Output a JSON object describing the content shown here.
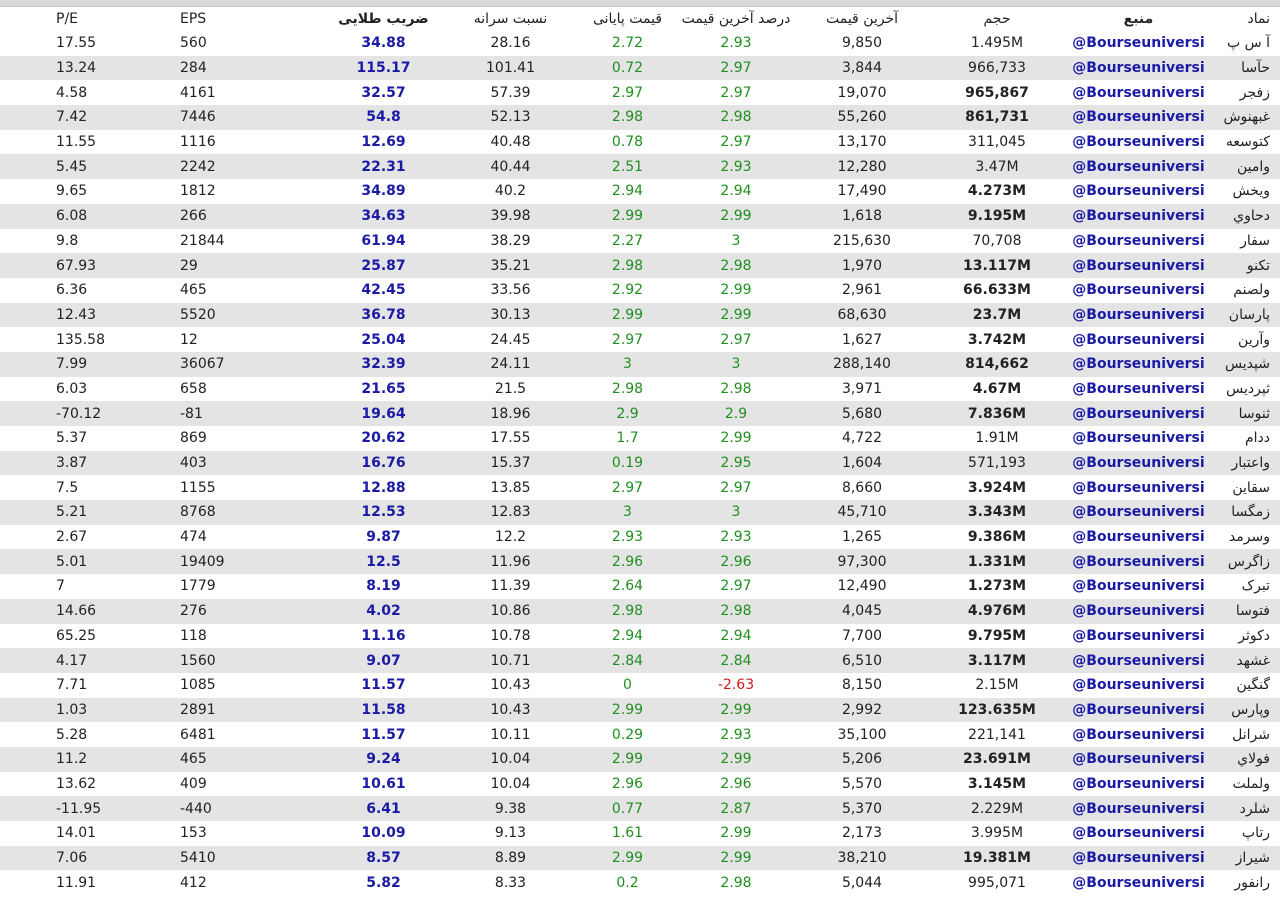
{
  "columns": {
    "pe": "P/E",
    "eps": "EPS",
    "gold": "ضریب طلایی",
    "ratio": "نسبت سرانه",
    "final": "قیمت پایانی",
    "pct_last": "درصد آخرین قیمت",
    "last": "آخرین قیمت",
    "volume": "حجم",
    "source": "منبع",
    "symbol": "نماد"
  },
  "rows": [
    {
      "pe": "17.55",
      "eps": "560",
      "gold": "34.88",
      "ratio": "28.16",
      "final": "2.72",
      "pct": "2.93",
      "last": "9,850",
      "vol": "1.495M",
      "vol_bold": false,
      "src": "@Bourseuniversi",
      "sym": "آ س پ",
      "pct_neg": false
    },
    {
      "pe": "13.24",
      "eps": "284",
      "gold": "115.17",
      "ratio": "101.41",
      "final": "0.72",
      "pct": "2.97",
      "last": "3,844",
      "vol": "966,733",
      "vol_bold": false,
      "src": "@Bourseuniversi",
      "sym": "حآسا",
      "pct_neg": false
    },
    {
      "pe": "4.58",
      "eps": "4161",
      "gold": "32.57",
      "ratio": "57.39",
      "final": "2.97",
      "pct": "2.97",
      "last": "19,070",
      "vol": "965,867",
      "vol_bold": true,
      "src": "@Bourseuniversi",
      "sym": "زفجر",
      "pct_neg": false
    },
    {
      "pe": "7.42",
      "eps": "7446",
      "gold": "54.8",
      "ratio": "52.13",
      "final": "2.98",
      "pct": "2.98",
      "last": "55,260",
      "vol": "861,731",
      "vol_bold": true,
      "src": "@Bourseuniversi",
      "sym": "غبهنوش",
      "pct_neg": false
    },
    {
      "pe": "11.55",
      "eps": "1116",
      "gold": "12.69",
      "ratio": "40.48",
      "final": "0.78",
      "pct": "2.97",
      "last": "13,170",
      "vol": "311,045",
      "vol_bold": false,
      "src": "@Bourseuniversi",
      "sym": "کتوسعه",
      "pct_neg": false
    },
    {
      "pe": "5.45",
      "eps": "2242",
      "gold": "22.31",
      "ratio": "40.44",
      "final": "2.51",
      "pct": "2.93",
      "last": "12,280",
      "vol": "3.47M",
      "vol_bold": false,
      "src": "@Bourseuniversi",
      "sym": "وامین",
      "pct_neg": false
    },
    {
      "pe": "9.65",
      "eps": "1812",
      "gold": "34.89",
      "ratio": "40.2",
      "final": "2.94",
      "pct": "2.94",
      "last": "17,490",
      "vol": "4.273M",
      "vol_bold": true,
      "src": "@Bourseuniversi",
      "sym": "ویخش",
      "pct_neg": false
    },
    {
      "pe": "6.08",
      "eps": "266",
      "gold": "34.63",
      "ratio": "39.98",
      "final": "2.99",
      "pct": "2.99",
      "last": "1,618",
      "vol": "9.195M",
      "vol_bold": true,
      "src": "@Bourseuniversi",
      "sym": "دحاوي",
      "pct_neg": false
    },
    {
      "pe": "9.8",
      "eps": "21844",
      "gold": "61.94",
      "ratio": "38.29",
      "final": "2.27",
      "pct": "3",
      "last": "215,630",
      "vol": "70,708",
      "vol_bold": false,
      "src": "@Bourseuniversi",
      "sym": "سفار",
      "pct_neg": false
    },
    {
      "pe": "67.93",
      "eps": "29",
      "gold": "25.87",
      "ratio": "35.21",
      "final": "2.98",
      "pct": "2.98",
      "last": "1,970",
      "vol": "13.117M",
      "vol_bold": true,
      "src": "@Bourseuniversi",
      "sym": "تکنو",
      "pct_neg": false
    },
    {
      "pe": "6.36",
      "eps": "465",
      "gold": "42.45",
      "ratio": "33.56",
      "final": "2.92",
      "pct": "2.99",
      "last": "2,961",
      "vol": "66.633M",
      "vol_bold": true,
      "src": "@Bourseuniversi",
      "sym": "ولصنم",
      "pct_neg": false
    },
    {
      "pe": "12.43",
      "eps": "5520",
      "gold": "36.78",
      "ratio": "30.13",
      "final": "2.99",
      "pct": "2.99",
      "last": "68,630",
      "vol": "23.7M",
      "vol_bold": true,
      "src": "@Bourseuniversi",
      "sym": "پارسان",
      "pct_neg": false
    },
    {
      "pe": "135.58",
      "eps": "12",
      "gold": "25.04",
      "ratio": "24.45",
      "final": "2.97",
      "pct": "2.97",
      "last": "1,627",
      "vol": "3.742M",
      "vol_bold": true,
      "src": "@Bourseuniversi",
      "sym": "وآرین",
      "pct_neg": false
    },
    {
      "pe": "7.99",
      "eps": "36067",
      "gold": "32.39",
      "ratio": "24.11",
      "final": "3",
      "pct": "3",
      "last": "288,140",
      "vol": "814,662",
      "vol_bold": true,
      "src": "@Bourseuniversi",
      "sym": "شپدیس",
      "pct_neg": false
    },
    {
      "pe": "6.03",
      "eps": "658",
      "gold": "21.65",
      "ratio": "21.5",
      "final": "2.98",
      "pct": "2.98",
      "last": "3,971",
      "vol": "4.67M",
      "vol_bold": true,
      "src": "@Bourseuniversi",
      "sym": "ثپردیس",
      "pct_neg": false
    },
    {
      "pe": "-70.12",
      "eps": "-81",
      "gold": "19.64",
      "ratio": "18.96",
      "final": "2.9",
      "pct": "2.9",
      "last": "5,680",
      "vol": "7.836M",
      "vol_bold": true,
      "src": "@Bourseuniversi",
      "sym": "ثنوسا",
      "pct_neg": false
    },
    {
      "pe": "5.37",
      "eps": "869",
      "gold": "20.62",
      "ratio": "17.55",
      "final": "1.7",
      "pct": "2.99",
      "last": "4,722",
      "vol": "1.91M",
      "vol_bold": false,
      "src": "@Bourseuniversi",
      "sym": "ددام",
      "pct_neg": false
    },
    {
      "pe": "3.87",
      "eps": "403",
      "gold": "16.76",
      "ratio": "15.37",
      "final": "0.19",
      "pct": "2.95",
      "last": "1,604",
      "vol": "571,193",
      "vol_bold": false,
      "src": "@Bourseuniversi",
      "sym": "واعتبار",
      "pct_neg": false
    },
    {
      "pe": "7.5",
      "eps": "1155",
      "gold": "12.88",
      "ratio": "13.85",
      "final": "2.97",
      "pct": "2.97",
      "last": "8,660",
      "vol": "3.924M",
      "vol_bold": true,
      "src": "@Bourseuniversi",
      "sym": "سقاین",
      "pct_neg": false
    },
    {
      "pe": "5.21",
      "eps": "8768",
      "gold": "12.53",
      "ratio": "12.83",
      "final": "3",
      "pct": "3",
      "last": "45,710",
      "vol": "3.343M",
      "vol_bold": true,
      "src": "@Bourseuniversi",
      "sym": "زمگسا",
      "pct_neg": false
    },
    {
      "pe": "2.67",
      "eps": "474",
      "gold": "9.87",
      "ratio": "12.2",
      "final": "2.93",
      "pct": "2.93",
      "last": "1,265",
      "vol": "9.386M",
      "vol_bold": true,
      "src": "@Bourseuniversi",
      "sym": "وسرمد",
      "pct_neg": false
    },
    {
      "pe": "5.01",
      "eps": "19409",
      "gold": "12.5",
      "ratio": "11.96",
      "final": "2.96",
      "pct": "2.96",
      "last": "97,300",
      "vol": "1.331M",
      "vol_bold": true,
      "src": "@Bourseuniversi",
      "sym": "زاگرس",
      "pct_neg": false
    },
    {
      "pe": "7",
      "eps": "1779",
      "gold": "8.19",
      "ratio": "11.39",
      "final": "2.64",
      "pct": "2.97",
      "last": "12,490",
      "vol": "1.273M",
      "vol_bold": true,
      "src": "@Bourseuniversi",
      "sym": "تبرک",
      "pct_neg": false
    },
    {
      "pe": "14.66",
      "eps": "276",
      "gold": "4.02",
      "ratio": "10.86",
      "final": "2.98",
      "pct": "2.98",
      "last": "4,045",
      "vol": "4.976M",
      "vol_bold": true,
      "src": "@Bourseuniversi",
      "sym": "فتوسا",
      "pct_neg": false
    },
    {
      "pe": "65.25",
      "eps": "118",
      "gold": "11.16",
      "ratio": "10.78",
      "final": "2.94",
      "pct": "2.94",
      "last": "7,700",
      "vol": "9.795M",
      "vol_bold": true,
      "src": "@Bourseuniversi",
      "sym": "دکوثر",
      "pct_neg": false
    },
    {
      "pe": "4.17",
      "eps": "1560",
      "gold": "9.07",
      "ratio": "10.71",
      "final": "2.84",
      "pct": "2.84",
      "last": "6,510",
      "vol": "3.117M",
      "vol_bold": true,
      "src": "@Bourseuniversi",
      "sym": "غشهد",
      "pct_neg": false
    },
    {
      "pe": "7.71",
      "eps": "1085",
      "gold": "11.57",
      "ratio": "10.43",
      "final": "0",
      "pct": "-2.63",
      "last": "8,150",
      "vol": "2.15M",
      "vol_bold": false,
      "src": "@Bourseuniversi",
      "sym": "گنگین",
      "pct_neg": true
    },
    {
      "pe": "1.03",
      "eps": "2891",
      "gold": "11.58",
      "ratio": "10.43",
      "final": "2.99",
      "pct": "2.99",
      "last": "2,992",
      "vol": "123.635M",
      "vol_bold": true,
      "src": "@Bourseuniversi",
      "sym": "وپارس",
      "pct_neg": false
    },
    {
      "pe": "5.28",
      "eps": "6481",
      "gold": "11.57",
      "ratio": "10.11",
      "final": "0.29",
      "pct": "2.93",
      "last": "35,100",
      "vol": "221,141",
      "vol_bold": false,
      "src": "@Bourseuniversi",
      "sym": "شرانل",
      "pct_neg": false
    },
    {
      "pe": "11.2",
      "eps": "465",
      "gold": "9.24",
      "ratio": "10.04",
      "final": "2.99",
      "pct": "2.99",
      "last": "5,206",
      "vol": "23.691M",
      "vol_bold": true,
      "src": "@Bourseuniversi",
      "sym": "فولاي",
      "pct_neg": false
    },
    {
      "pe": "13.62",
      "eps": "409",
      "gold": "10.61",
      "ratio": "10.04",
      "final": "2.96",
      "pct": "2.96",
      "last": "5,570",
      "vol": "3.145M",
      "vol_bold": true,
      "src": "@Bourseuniversi",
      "sym": "ولملت",
      "pct_neg": false
    },
    {
      "pe": "-11.95",
      "eps": "-440",
      "gold": "6.41",
      "ratio": "9.38",
      "final": "0.77",
      "pct": "2.87",
      "last": "5,370",
      "vol": "2.229M",
      "vol_bold": false,
      "src": "@Bourseuniversi",
      "sym": "شلرد",
      "pct_neg": false
    },
    {
      "pe": "14.01",
      "eps": "153",
      "gold": "10.09",
      "ratio": "9.13",
      "final": "1.61",
      "pct": "2.99",
      "last": "2,173",
      "vol": "3.995M",
      "vol_bold": false,
      "src": "@Bourseuniversi",
      "sym": "رتاپ",
      "pct_neg": false
    },
    {
      "pe": "7.06",
      "eps": "5410",
      "gold": "8.57",
      "ratio": "8.89",
      "final": "2.99",
      "pct": "2.99",
      "last": "38,210",
      "vol": "19.381M",
      "vol_bold": true,
      "src": "@Bourseuniversi",
      "sym": "شیراز",
      "pct_neg": false
    },
    {
      "pe": "11.91",
      "eps": "412",
      "gold": "5.82",
      "ratio": "8.33",
      "final": "0.2",
      "pct": "2.98",
      "last": "5,044",
      "vol": "995,071",
      "vol_bold": false,
      "src": "@Bourseuniversi",
      "sym": "رانفور",
      "pct_neg": false
    }
  ]
}
